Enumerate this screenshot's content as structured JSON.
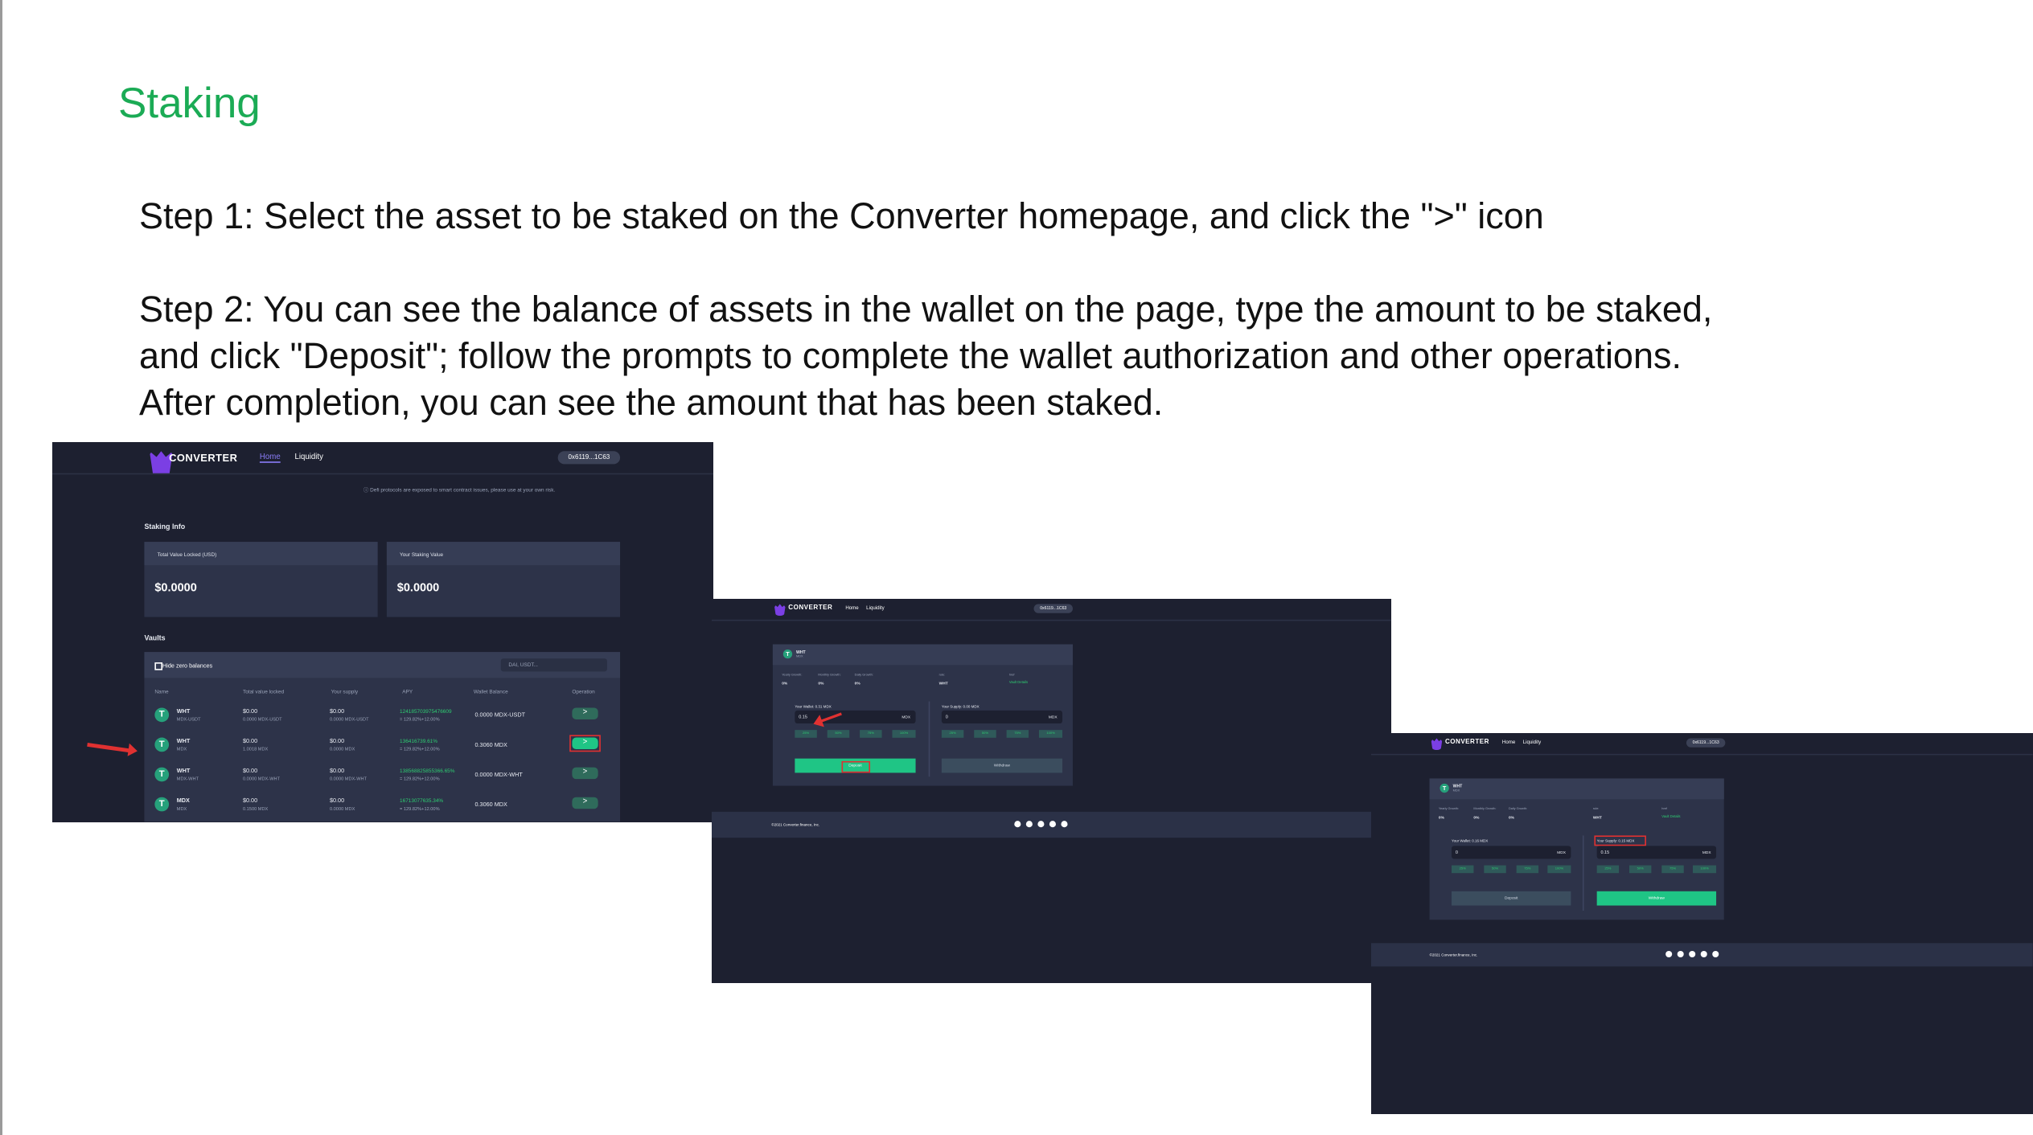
{
  "page": {
    "title": "Staking",
    "step1": "Step 1: Select the asset to be staked on the Converter homepage, and click the \">\" icon",
    "step2_lines": [
      "Step 2: You can see the balance of assets in the wallet on the page, type the amount to be staked,",
      "and click \"Deposit\"; follow the prompts to complete the wallet authorization and other operations.",
      "After completion, you can see the amount that has been staked."
    ]
  },
  "common": {
    "brand": "CONVERTER",
    "nav_home": "Home",
    "nav_liquidity": "Liquidity",
    "wallet": "0x6119...1C63",
    "footer_copy": "©2021 Converter.finance,  Inc."
  },
  "shot1": {
    "notice": "ⓘ Defi protocols are exposed to smart contract issues, please use at your own risk.",
    "staking_info": "Staking Info",
    "tvl_label": "Total Value Locked (USD)",
    "tvl_value": "$0.0000",
    "your_staking_label": "Your Staking Value",
    "your_staking_value": "$0.0000",
    "vaults": "Vaults",
    "hide_zero": "Hide zero balances",
    "search_placeholder": "DAI, USDT...",
    "columns": [
      "Name",
      "Total value locked",
      "Your supply",
      "APY",
      "Wallet Balance",
      "Operation"
    ],
    "rows": [
      {
        "token": "WHT",
        "sub": "MDX-USDT",
        "tvl": "$0.00",
        "tvl_sub": "0.0000 MDX-USDT",
        "supply": "$0.00",
        "supply_sub": "0.0000 MDX-USDT",
        "apy": "124185703975476609",
        "apy_sub": "= 129.82%+12.00%",
        "balance": "0.0000 MDX-USDT"
      },
      {
        "token": "WHT",
        "sub": "MDX",
        "tvl": "$0.00",
        "tvl_sub": "1.0018 MDX",
        "supply": "$0.00",
        "supply_sub": "0.0000 MDX",
        "apy": "136416739.61%",
        "apy_sub": "= 129.82%+12.00%",
        "balance": "0.3060 MDX"
      },
      {
        "token": "WHT",
        "sub": "MDX-WHT",
        "tvl": "$0.00",
        "tvl_sub": "0.0000 MDX-WHT",
        "supply": "$0.00",
        "supply_sub": "0.0000 MDX-WHT",
        "apy": "138568825855366.65%",
        "apy_sub": "= 129.82%+12.00%",
        "balance": "0.0000 MDX-WHT"
      },
      {
        "token": "MDX",
        "sub": "MDX",
        "tvl": "$0.00",
        "tvl_sub": "0.1500 MDX",
        "supply": "$0.00",
        "supply_sub": "0.0000 MDX",
        "apy": "16713077635.34%",
        "apy_sub": "= 129.82%+12.00%",
        "balance": "0.3060 MDX"
      }
    ],
    "op_symbol": ">"
  },
  "vault": {
    "token": "WHT",
    "token_sub": "MDX",
    "yearly_label": "Yearly Growth:",
    "monthly_label": "Monthly Growth:",
    "daily_label": "Daily Growth:",
    "yearly": "0%",
    "monthly": "0%",
    "daily": "0%",
    "rule_label": "rule:",
    "rule_value": "WHT",
    "href_label": "href",
    "href_value": "Vault Details",
    "unit": "MDX",
    "pcts": [
      "25%",
      "50%",
      "75%",
      "100%"
    ],
    "deposit": "Deposit",
    "withdraw": "Withdraw"
  },
  "shot2": {
    "wallet_label": "Your Wallet: 0.31 MDX",
    "supply_label": "Your Supply: 0.00 MDX",
    "deposit_input": "0.15",
    "withdraw_input": "0"
  },
  "shot3": {
    "wallet_label": "Your Wallet: 0.16 MDX",
    "supply_label": "Your Supply: 0.15 MDX",
    "deposit_input": "0",
    "withdraw_input": "0.15"
  },
  "colors": {
    "accent": "#1bab55",
    "button_green": "#1fc585",
    "highlight_red": "#e03131",
    "bg_dark": "#1d2030"
  }
}
